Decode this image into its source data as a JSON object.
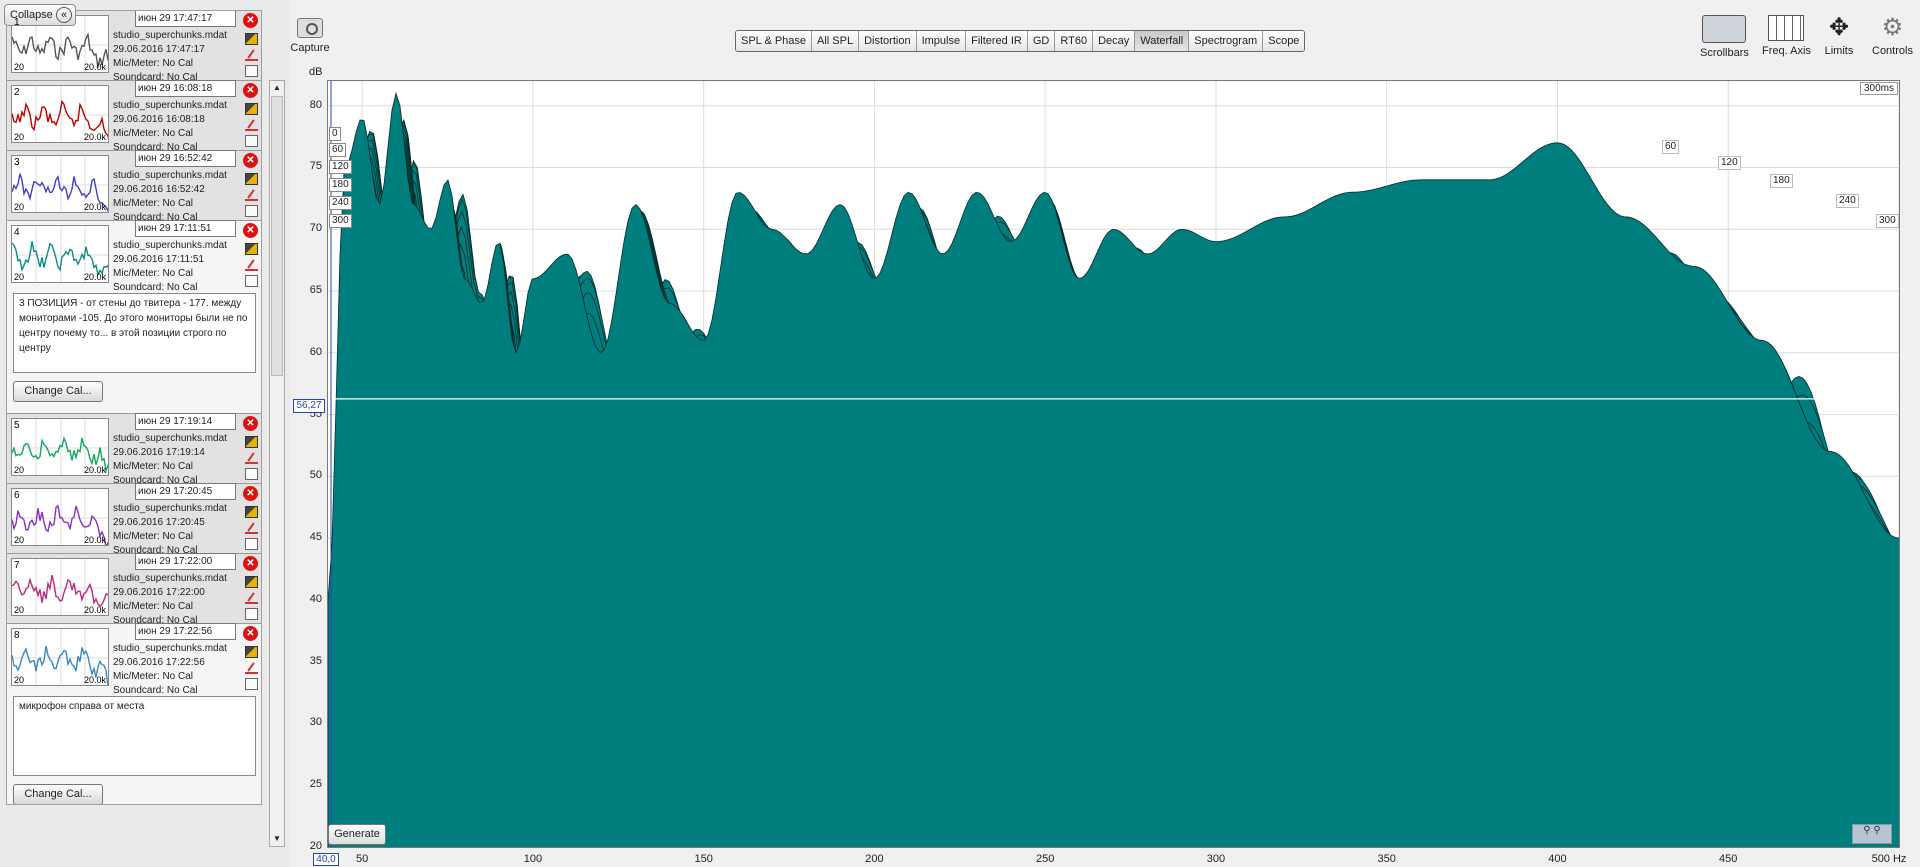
{
  "sidebar": {
    "collapse_label": "Collapse",
    "measurements": [
      {
        "index": "1",
        "name": "июн 29 17:47:17",
        "file": "studio_superchunks.mdat",
        "date": "29.06.2016 17:47:17",
        "mic": "Mic/Meter: No Cal",
        "sound": "Soundcard: No Cal",
        "f_lo": "20",
        "f_hi": "20.0k",
        "color": "#555555"
      },
      {
        "index": "2",
        "name": "июн 29 16:08:18",
        "file": "studio_superchunks.mdat",
        "date": "29.06.2016 16:08:18",
        "mic": "Mic/Meter: No Cal",
        "sound": "Soundcard: No Cal",
        "f_lo": "20",
        "f_hi": "20.0k",
        "color": "#c00000"
      },
      {
        "index": "3",
        "name": "июн 29 16:52:42",
        "file": "studio_superchunks.mdat",
        "date": "29.06.2016 16:52:42",
        "mic": "Mic/Meter: No Cal",
        "sound": "Soundcard: No Cal",
        "f_lo": "20",
        "f_hi": "20.0k",
        "color": "#4040c8"
      },
      {
        "index": "4",
        "name": "июн 29 17:11:51",
        "file": "studio_superchunks.mdat",
        "date": "29.06.2016 17:11:51",
        "mic": "Mic/Meter: No Cal",
        "sound": "Soundcard: No Cal",
        "f_lo": "20",
        "f_hi": "20.0k",
        "color": "#0e8a82",
        "notes": "3 ПОЗИЦИЯ - от стены до твитера - 177. между мониторами -105. До этого мониторы были не по центру почему то... в этой позиции строго по центру",
        "cal_button": "Change Cal..."
      },
      {
        "index": "5",
        "name": "июн 29 17:19:14",
        "file": "studio_superchunks.mdat",
        "date": "29.06.2016 17:19:14",
        "mic": "Mic/Meter: No Cal",
        "sound": "Soundcard: No Cal",
        "f_lo": "20",
        "f_hi": "20.0k",
        "color": "#10a860"
      },
      {
        "index": "6",
        "name": "июн 29 17:20:45",
        "file": "studio_superchunks.mdat",
        "date": "29.06.2016 17:20:45",
        "mic": "Mic/Meter: No Cal",
        "sound": "Soundcard: No Cal",
        "f_lo": "20",
        "f_hi": "20.0k",
        "color": "#8a30c0"
      },
      {
        "index": "7",
        "name": "июн 29 17:22:00",
        "file": "studio_superchunks.mdat",
        "date": "29.06.2016 17:22:00",
        "mic": "Mic/Meter: No Cal",
        "sound": "Soundcard: No Cal",
        "f_lo": "20",
        "f_hi": "20.0k",
        "color": "#c02880"
      },
      {
        "index": "8",
        "name": "июн 29 17:22:56",
        "file": "studio_superchunks.mdat",
        "date": "29.06.2016 17:22:56",
        "mic": "Mic/Meter: No Cal",
        "sound": "Soundcard: No Cal",
        "f_lo": "20",
        "f_hi": "20.0k",
        "color": "#3a88c0",
        "notes": "микрофон справа от места",
        "cal_button": "Change Cal..."
      }
    ]
  },
  "toolbar": {
    "capture_label": "Capture",
    "tabs": [
      "SPL & Phase",
      "All SPL",
      "Distortion",
      "Impulse",
      "Filtered IR",
      "GD",
      "RT60",
      "Decay",
      "Waterfall",
      "Spectrogram",
      "Scope"
    ],
    "active_tab": "Waterfall",
    "right_tools": [
      "Scrollbars",
      "Freq. Axis",
      "Limits",
      "Controls"
    ]
  },
  "graph": {
    "y_unit": "dB",
    "y_ticks": [
      "80",
      "75",
      "70",
      "65",
      "60",
      "55",
      "50",
      "45",
      "40",
      "35",
      "30",
      "25",
      "20"
    ],
    "x_ticks": [
      "50",
      "100",
      "150",
      "200",
      "250",
      "300",
      "350",
      "400",
      "450",
      "500 Hz"
    ],
    "cursor_db": "56,27",
    "cursor_hz": "40,0",
    "time_span": "300ms",
    "time_labels_left": [
      "0",
      "60",
      "120",
      "180",
      "240",
      "300"
    ],
    "time_labels_right": [
      "60",
      "120",
      "180",
      "240",
      "300"
    ],
    "generate_label": "Generate",
    "colors": {
      "fill": "#007d7d",
      "accent": "#2646ad"
    }
  },
  "chart_data": {
    "type": "area",
    "plot_kind": "waterfall",
    "x_axis": {
      "unit": "Hz",
      "range": [
        40,
        500
      ],
      "ticks": [
        50,
        100,
        150,
        200,
        250,
        300,
        350,
        400,
        450,
        500
      ]
    },
    "y_axis": {
      "unit": "dB",
      "range": [
        20,
        82
      ],
      "ticks": [
        20,
        25,
        30,
        35,
        40,
        45,
        50,
        55,
        60,
        65,
        70,
        75,
        80
      ]
    },
    "time_axis": {
      "unit": "ms",
      "range": [
        0,
        300
      ],
      "ticks": [
        0,
        60,
        120,
        180,
        240,
        300
      ]
    },
    "grid": true,
    "front_slice": {
      "name": "",
      "x": [
        40,
        45,
        50,
        55,
        60,
        65,
        70,
        75,
        80,
        85,
        90,
        95,
        100,
        110,
        120,
        130,
        140,
        150,
        160,
        170,
        180,
        190,
        200,
        210,
        220,
        230,
        240,
        250,
        260,
        270,
        280,
        290,
        300,
        320,
        340,
        360,
        380,
        400,
        420,
        440,
        460,
        480,
        500
      ],
      "y": [
        40,
        75,
        79,
        72,
        81,
        72,
        70,
        74,
        66,
        64,
        69,
        60,
        66,
        68,
        60,
        72,
        64,
        61,
        73,
        70,
        68,
        72,
        66,
        73,
        68,
        73,
        69,
        73,
        66,
        70,
        68,
        70,
        69,
        71,
        73,
        74,
        74,
        77,
        71,
        67,
        61,
        52,
        45
      ]
    }
  }
}
